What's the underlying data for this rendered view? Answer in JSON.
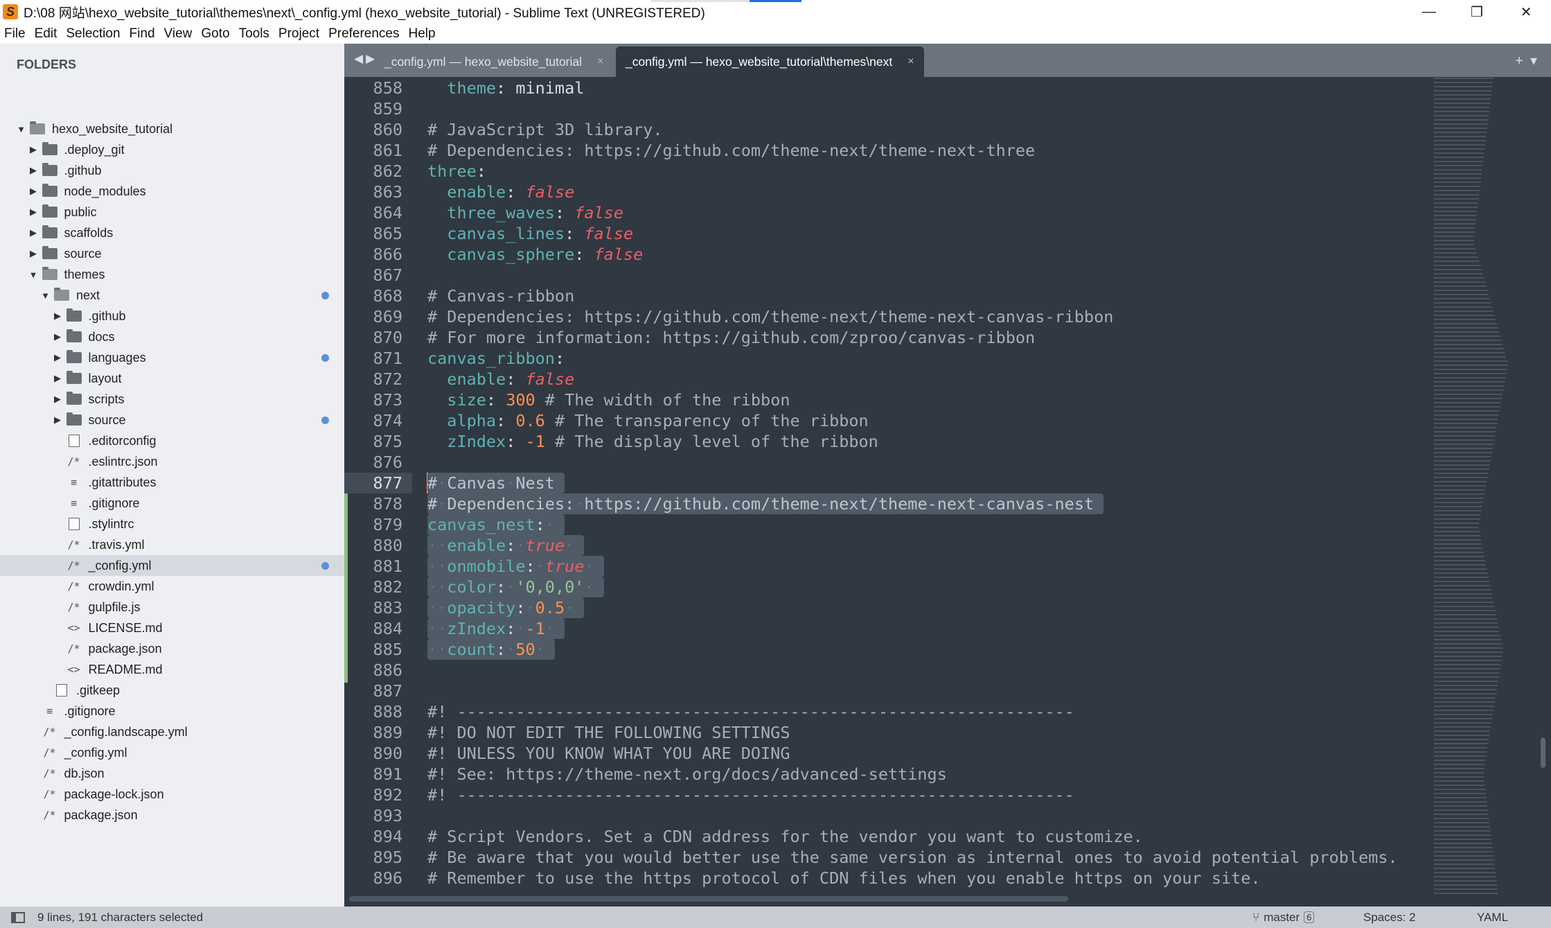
{
  "window": {
    "title": "D:\\08 网站\\hexo_website_tutorial\\themes\\next\\_config.yml (hexo_website_tutorial) - Sublime Text (UNREGISTERED)",
    "minimize": "—",
    "restore": "❐",
    "close": "✕"
  },
  "menu": [
    "File",
    "Edit",
    "Selection",
    "Find",
    "View",
    "Goto",
    "Tools",
    "Project",
    "Preferences",
    "Help"
  ],
  "sidebar": {
    "heading": "FOLDERS",
    "items": [
      {
        "label": "hexo_website_tutorial",
        "depth": 0,
        "type": "folder",
        "open": true
      },
      {
        "label": ".deploy_git",
        "depth": 1,
        "type": "folder"
      },
      {
        "label": ".github",
        "depth": 1,
        "type": "folder"
      },
      {
        "label": "node_modules",
        "depth": 1,
        "type": "folder"
      },
      {
        "label": "public",
        "depth": 1,
        "type": "folder"
      },
      {
        "label": "scaffolds",
        "depth": 1,
        "type": "folder"
      },
      {
        "label": "source",
        "depth": 1,
        "type": "folder"
      },
      {
        "label": "themes",
        "depth": 1,
        "type": "folder",
        "open": true
      },
      {
        "label": "next",
        "depth": 2,
        "type": "folder",
        "open": true,
        "modified": true
      },
      {
        "label": ".github",
        "depth": 3,
        "type": "folder"
      },
      {
        "label": "docs",
        "depth": 3,
        "type": "folder"
      },
      {
        "label": "languages",
        "depth": 3,
        "type": "folder",
        "modified": true
      },
      {
        "label": "layout",
        "depth": 3,
        "type": "folder"
      },
      {
        "label": "scripts",
        "depth": 3,
        "type": "folder"
      },
      {
        "label": "source",
        "depth": 3,
        "type": "folder",
        "modified": true
      },
      {
        "label": ".editorconfig",
        "depth": 3,
        "type": "file",
        "icon": "file"
      },
      {
        "label": ".eslintrc.json",
        "depth": 3,
        "type": "file",
        "icon": "/*"
      },
      {
        "label": ".gitattributes",
        "depth": 3,
        "type": "file",
        "icon": "≡"
      },
      {
        "label": ".gitignore",
        "depth": 3,
        "type": "file",
        "icon": "≡"
      },
      {
        "label": ".stylintrc",
        "depth": 3,
        "type": "file",
        "icon": "file"
      },
      {
        "label": ".travis.yml",
        "depth": 3,
        "type": "file",
        "icon": "/*"
      },
      {
        "label": "_config.yml",
        "depth": 3,
        "type": "file",
        "icon": "/*",
        "selected": true,
        "modified": true
      },
      {
        "label": "crowdin.yml",
        "depth": 3,
        "type": "file",
        "icon": "/*"
      },
      {
        "label": "gulpfile.js",
        "depth": 3,
        "type": "file",
        "icon": "/*"
      },
      {
        "label": "LICENSE.md",
        "depth": 3,
        "type": "file",
        "icon": "<>"
      },
      {
        "label": "package.json",
        "depth": 3,
        "type": "file",
        "icon": "/*"
      },
      {
        "label": "README.md",
        "depth": 3,
        "type": "file",
        "icon": "<>"
      },
      {
        "label": ".gitkeep",
        "depth": 2,
        "type": "file",
        "icon": "file"
      },
      {
        "label": ".gitignore",
        "depth": 1,
        "type": "file",
        "icon": "≡"
      },
      {
        "label": "_config.landscape.yml",
        "depth": 1,
        "type": "file",
        "icon": "/*"
      },
      {
        "label": "_config.yml",
        "depth": 1,
        "type": "file",
        "icon": "/*"
      },
      {
        "label": "db.json",
        "depth": 1,
        "type": "file",
        "icon": "/*"
      },
      {
        "label": "package-lock.json",
        "depth": 1,
        "type": "file",
        "icon": "/*"
      },
      {
        "label": "package.json",
        "depth": 1,
        "type": "file",
        "icon": "/*"
      }
    ]
  },
  "tabs": [
    {
      "label": "_config.yml — hexo_website_tutorial",
      "active": false
    },
    {
      "label": "_config.yml — hexo_website_tutorial\\themes\\next",
      "active": true
    }
  ],
  "tab_close": "×",
  "editor": {
    "first_line": 858,
    "current_line": 877,
    "selection": [
      877,
      885
    ],
    "lines": [
      "  theme: minimal",
      "",
      "# JavaScript 3D library.",
      "# Dependencies: https://github.com/theme-next/theme-next-three",
      "three:",
      "  enable: false",
      "  three_waves: false",
      "  canvas_lines: false",
      "  canvas_sphere: false",
      "",
      "# Canvas-ribbon",
      "# Dependencies: https://github.com/theme-next/theme-next-canvas-ribbon",
      "# For more information: https://github.com/zproo/canvas-ribbon",
      "canvas_ribbon:",
      "  enable: false",
      "  size: 300 # The width of the ribbon",
      "  alpha: 0.6 # The transparency of the ribbon",
      "  zIndex: -1 # The display level of the ribbon",
      "",
      "# Canvas Nest",
      "# Dependencies: https://github.com/theme-next/theme-next-canvas-nest",
      "canvas_nest:",
      "  enable: true",
      "  onmobile: true",
      "  color: '0,0,0'",
      "  opacity: 0.5",
      "  zIndex: -1",
      "  count: 50",
      "",
      "",
      "#! ---------------------------------------------------------------",
      "#! DO NOT EDIT THE FOLLOWING SETTINGS",
      "#! UNLESS YOU KNOW WHAT YOU ARE DOING",
      "#! See: https://theme-next.org/docs/advanced-settings",
      "#! ---------------------------------------------------------------",
      "",
      "# Script Vendors. Set a CDN address for the vendor you want to customize.",
      "# Be aware that you would better use the same version as internal ones to avoid potential problems.",
      "# Remember to use the https protocol of CDN files when you enable https on your site."
    ]
  },
  "status": {
    "selection": "9 lines, 191 characters selected",
    "branch": "master",
    "branch_changes": "6",
    "spaces": "Spaces: 2",
    "syntax": "YAML"
  },
  "colors": {
    "editor_bg": "#303841",
    "sidebar_bg": "#edeff2",
    "key": "#5fb3b3",
    "boolean": "#ec5f67",
    "number": "#f99157",
    "string": "#99c794",
    "comment": "#a7adba"
  }
}
